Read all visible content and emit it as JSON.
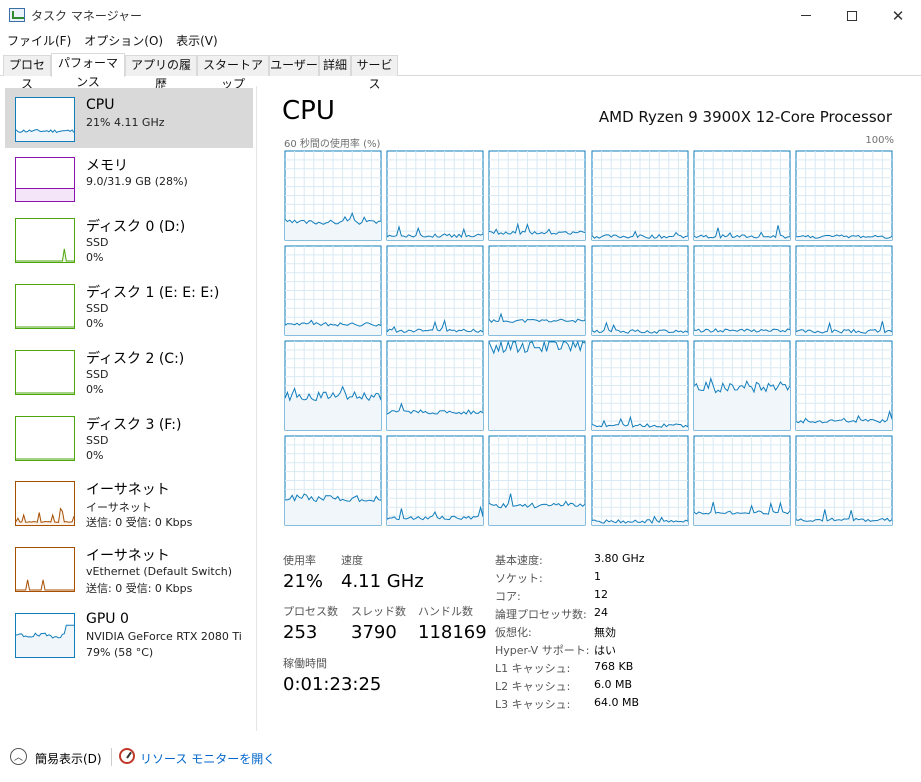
{
  "window": {
    "title": "タスク マネージャー",
    "minimize_glyph": "",
    "close_glyph": "✕"
  },
  "menu": [
    "ファイル(F)",
    "オプション(O)",
    "表示(V)"
  ],
  "tabs": [
    {
      "label": "プロセス",
      "active": false
    },
    {
      "label": "パフォーマンス",
      "active": true
    },
    {
      "label": "アプリの履歴",
      "active": false
    },
    {
      "label": "スタートアップ",
      "active": false
    },
    {
      "label": "ユーザー",
      "active": false
    },
    {
      "label": "詳細",
      "active": false
    },
    {
      "label": "サービス",
      "active": false
    }
  ],
  "colors": {
    "cpu": "#117dbb",
    "cpu_fill": "#f1f6fa",
    "memory": "#8b12ae",
    "disk": "#4da60c",
    "ethernet": "#a74f01",
    "gpu": "#117dbb",
    "grid": "#d9eaf4"
  },
  "sidebar": [
    {
      "id": "cpu",
      "title": "CPU",
      "lines": [
        "21%  4.11 GHz"
      ],
      "selected": true
    },
    {
      "id": "memory",
      "title": "メモリ",
      "lines": [
        "9.0/31.9 GB (28%)"
      ],
      "selected": false
    },
    {
      "id": "disk0",
      "title": "ディスク 0 (D:)",
      "lines": [
        "SSD",
        "0%"
      ],
      "selected": false
    },
    {
      "id": "disk1",
      "title": "ディスク 1 (E: E: E:)",
      "lines": [
        "SSD",
        "0%"
      ],
      "selected": false
    },
    {
      "id": "disk2",
      "title": "ディスク 2 (C:)",
      "lines": [
        "SSD",
        "0%"
      ],
      "selected": false
    },
    {
      "id": "disk3",
      "title": "ディスク 3 (F:)",
      "lines": [
        "SSD",
        "0%"
      ],
      "selected": false
    },
    {
      "id": "eth1",
      "title": "イーサネット",
      "lines": [
        "イーサネット",
        "送信: 0 受信: 0 Kbps"
      ],
      "selected": false
    },
    {
      "id": "eth2",
      "title": "イーサネット",
      "lines": [
        "vEthernet (Default Switch)",
        "送信: 0 受信: 0 Kbps"
      ],
      "selected": false
    },
    {
      "id": "gpu0",
      "title": "GPU 0",
      "lines": [
        "NVIDIA GeForce RTX 2080 Ti",
        "79% (58 °C)"
      ],
      "selected": false
    }
  ],
  "main": {
    "title": "CPU",
    "model": "AMD Ryzen 9 3900X 12-Core Processor",
    "axis_label": "60 秒間の使用率 (%)",
    "axis_max": "100%",
    "core_levels": [
      0.2,
      0.05,
      0.08,
      0.04,
      0.04,
      0.04,
      0.12,
      0.05,
      0.16,
      0.04,
      0.05,
      0.04,
      0.38,
      0.2,
      0.95,
      0.05,
      0.48,
      0.1,
      0.3,
      0.08,
      0.22,
      0.04,
      0.14,
      0.06
    ],
    "stats": {
      "usage_label": "使用率",
      "usage_value": "21%",
      "speed_label": "速度",
      "speed_value": "4.11 GHz",
      "processes_label": "プロセス数",
      "processes_value": "253",
      "threads_label": "スレッド数",
      "threads_value": "3790",
      "handles_label": "ハンドル数",
      "handles_value": "118169",
      "uptime_label": "稼働時間",
      "uptime_value": "0:01:23:25"
    },
    "info": [
      {
        "key": "基本速度:",
        "value": "3.80 GHz"
      },
      {
        "key": "ソケット:",
        "value": "1"
      },
      {
        "key": "コア:",
        "value": "12"
      },
      {
        "key": "論理プロセッサ数:",
        "value": "24"
      },
      {
        "key": "仮想化:",
        "value": "無効"
      },
      {
        "key": "Hyper-V サポート:",
        "value": "はい"
      },
      {
        "key": "L1 キャッシュ:",
        "value": "768 KB"
      },
      {
        "key": "L2 キャッシュ:",
        "value": "6.0 MB"
      },
      {
        "key": "L3 キャッシュ:",
        "value": "64.0 MB"
      }
    ]
  },
  "footer": {
    "fewer_details": "簡易表示(D)",
    "resource_monitor": "リソース モニターを開く"
  }
}
